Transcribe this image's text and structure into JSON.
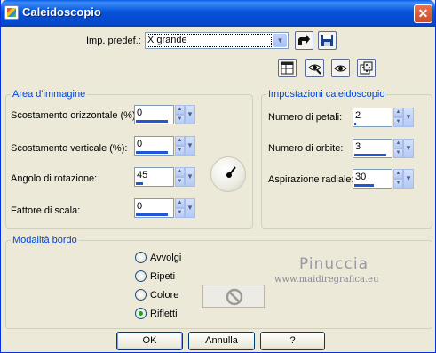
{
  "window": {
    "title": "Caleidoscopio"
  },
  "presets": {
    "label": "Imp. predef.:",
    "value": "X grande"
  },
  "area": {
    "title": "Area d'immagine",
    "fields": [
      {
        "label": "Scostamento orizzontale (%):",
        "value": "0"
      },
      {
        "label": "Scostamento verticale (%):",
        "value": "0"
      },
      {
        "label": "Angolo di rotazione:",
        "value": "45"
      },
      {
        "label": "Fattore di scala:",
        "value": "0"
      }
    ]
  },
  "kaleido": {
    "title": "Impostazioni caleidoscopio",
    "fields": [
      {
        "label": "Numero di petali:",
        "value": "2"
      },
      {
        "label": "Numero di orbite:",
        "value": "3"
      },
      {
        "label": "Aspirazione radiale:",
        "value": "30"
      }
    ]
  },
  "border_mode": {
    "title": "Modalità bordo",
    "options": [
      "Avvolgi",
      "Ripeti",
      "Colore",
      "Rifletti"
    ],
    "selected": "Rifletti"
  },
  "watermark": {
    "name": "Pinuccia",
    "site": "www.maidiregrafica.eu"
  },
  "buttons": {
    "ok": "OK",
    "cancel": "Annulla",
    "help": "?"
  },
  "icons": {
    "close": "close-icon",
    "tools": [
      "save-preset-icon",
      "disk-icon",
      "layout-icon",
      "preview-eye-icon",
      "eye-icon",
      "random-dice-icon"
    ],
    "angle": "angle-dial-icon",
    "no_color": "no-color-icon"
  }
}
